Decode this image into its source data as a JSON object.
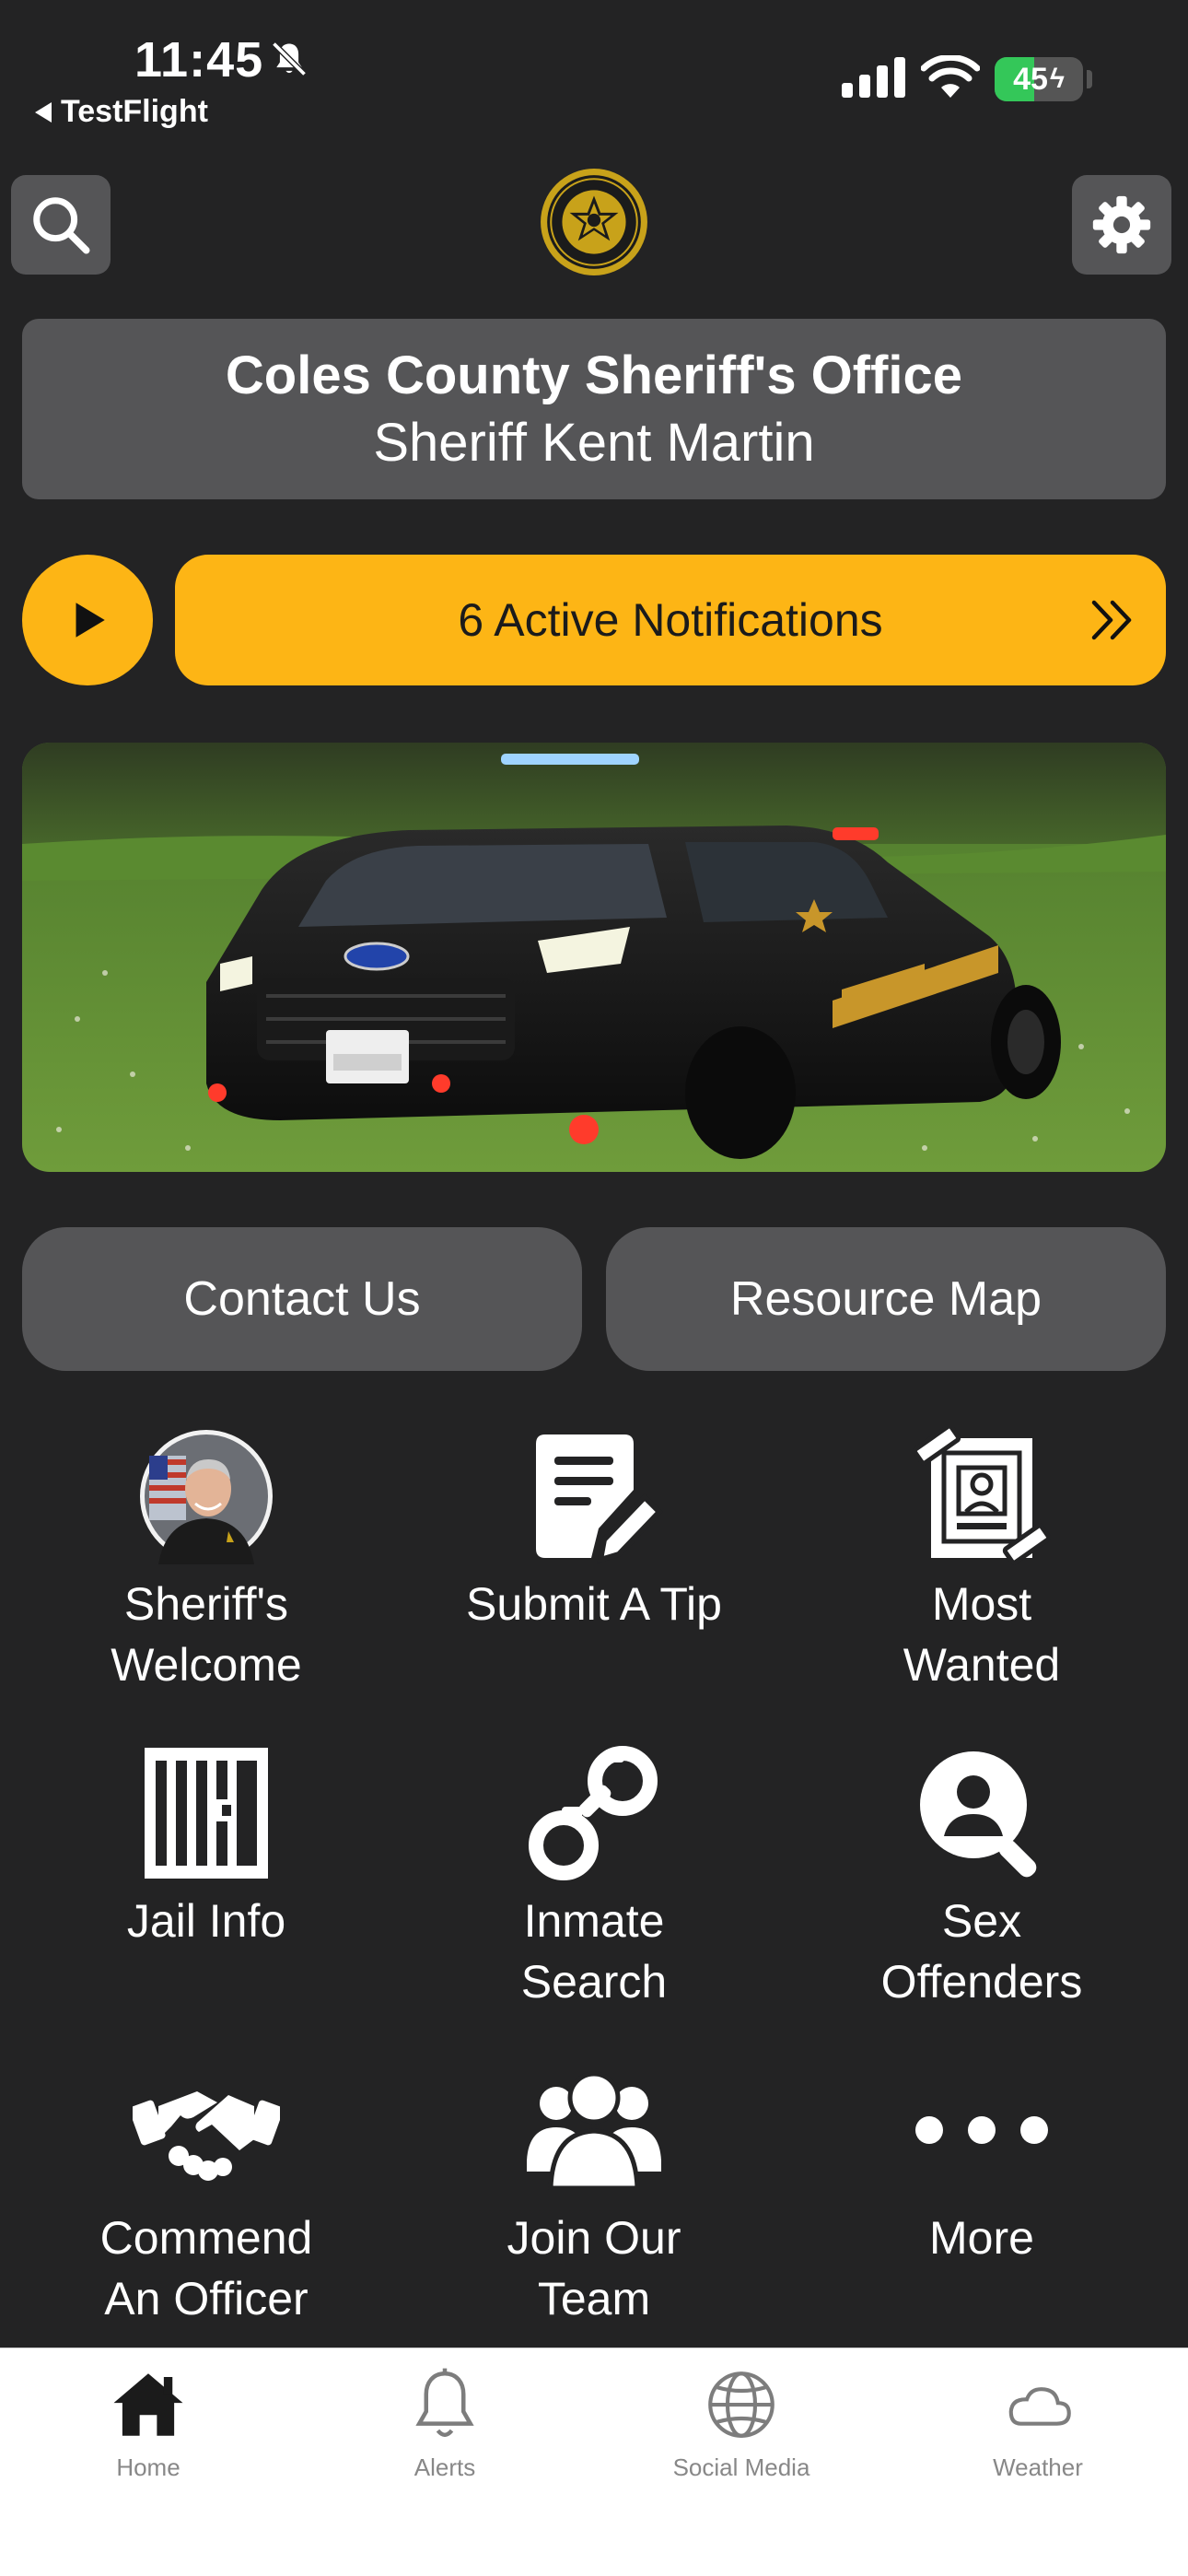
{
  "status": {
    "time": "11:45",
    "back_app": "TestFlight",
    "battery": "45",
    "battery_level": 0.45
  },
  "header": {
    "title": "Coles County Sheriff's Office",
    "subtitle": "Sheriff Kent Martin"
  },
  "notifications": {
    "label": "6 Active Notifications"
  },
  "buttons": {
    "contact": "Contact Us",
    "resource_map": "Resource Map"
  },
  "grid": [
    {
      "label": "Sheriff's\nWelcome",
      "icon": "sheriff-portrait-icon"
    },
    {
      "label": "Submit A Tip",
      "icon": "note-pen-icon"
    },
    {
      "label": "Most\nWanted",
      "icon": "wanted-poster-icon"
    },
    {
      "label": "Jail Info",
      "icon": "jail-bars-icon"
    },
    {
      "label": "Inmate\nSearch",
      "icon": "handcuffs-icon"
    },
    {
      "label": "Sex\nOffenders",
      "icon": "user-search-icon"
    },
    {
      "label": "Commend\nAn Officer",
      "icon": "handshake-icon"
    },
    {
      "label": "Join Our\nTeam",
      "icon": "users-group-icon"
    },
    {
      "label": "More",
      "icon": "more-dots-icon"
    }
  ],
  "tabs": [
    {
      "label": "Home",
      "icon": "home-icon"
    },
    {
      "label": "Alerts",
      "icon": "bell-icon"
    },
    {
      "label": "Social Media",
      "icon": "globe-icon"
    },
    {
      "label": "Weather",
      "icon": "cloud-icon"
    }
  ],
  "colors": {
    "accent": "#fdb515",
    "background": "#232324",
    "card": "#555557"
  }
}
